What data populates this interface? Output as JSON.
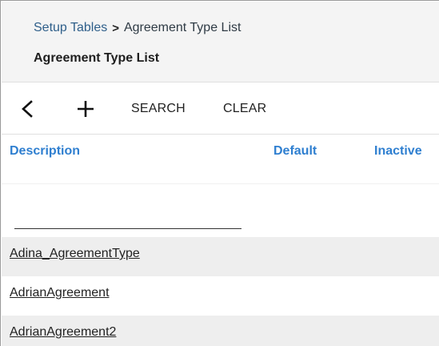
{
  "breadcrumb": {
    "parent": "Setup Tables",
    "separator": ">",
    "current": "Agreement Type List"
  },
  "page_title": "Agreement Type List",
  "toolbar": {
    "back_icon": "chevron-left-icon",
    "add_icon": "plus-icon",
    "search_label": "SEARCH",
    "clear_label": "CLEAR"
  },
  "table": {
    "columns": [
      "Description",
      "Default",
      "Inactive"
    ],
    "filter": {
      "value": ""
    },
    "rows": [
      {
        "description": "Adina_AgreementType"
      },
      {
        "description": "AdrianAgreement"
      },
      {
        "description": "AdrianAgreement2"
      }
    ]
  },
  "colors": {
    "header_bg": "#f4f4f4",
    "column_header": "#2f7fd0",
    "row_alt_bg": "#eeeeee"
  }
}
